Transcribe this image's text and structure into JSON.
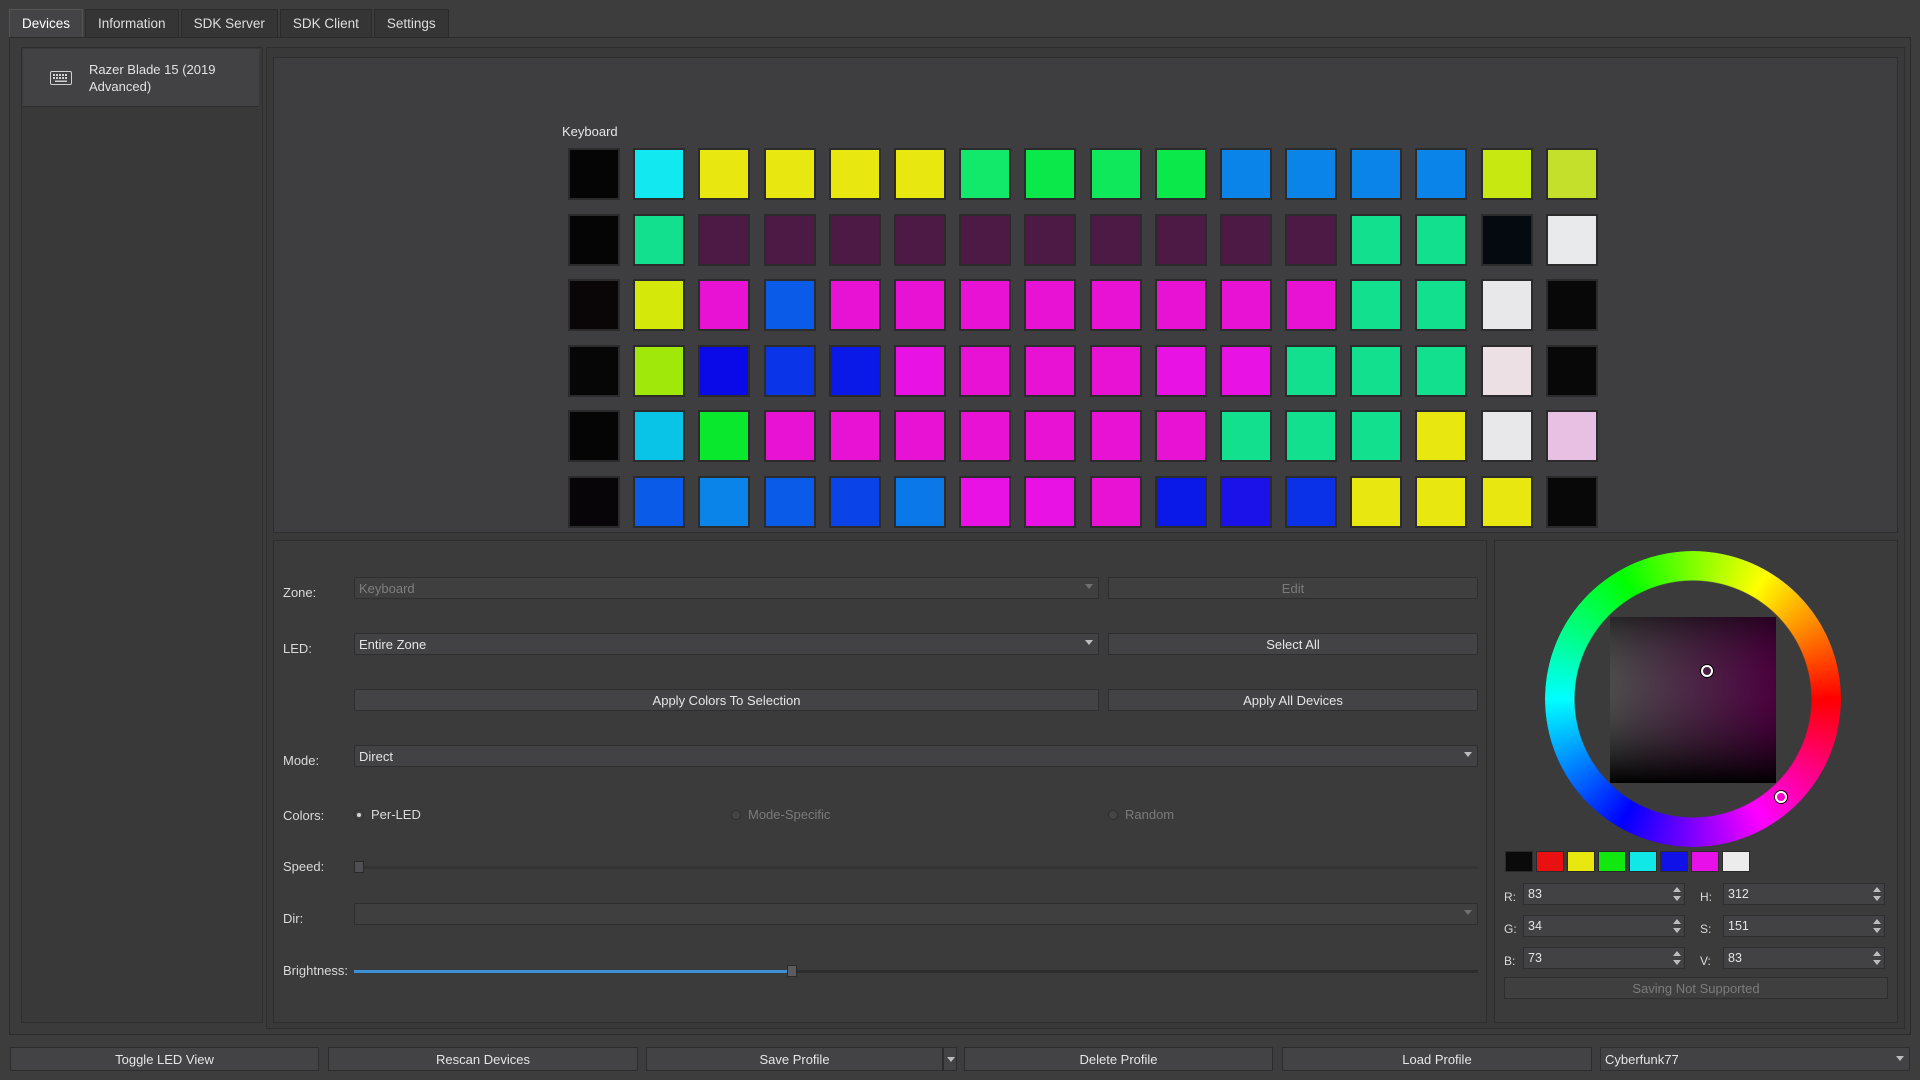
{
  "tabs": [
    {
      "label": "Devices",
      "active": true
    },
    {
      "label": "Information",
      "active": false
    },
    {
      "label": "SDK Server",
      "active": false
    },
    {
      "label": "SDK Client",
      "active": false
    },
    {
      "label": "Settings",
      "active": false
    }
  ],
  "devices": [
    {
      "name": "Razer Blade 15 (2019 Advanced)",
      "icon": "keyboard-icon"
    }
  ],
  "led_view": {
    "zone_label": "Keyboard",
    "rows": [
      [
        "#050505",
        "#12e8ef",
        "#e8e810",
        "#e8e810",
        "#e8e810",
        "#e8e810",
        "#12e86a",
        "#0ae84a",
        "#0ee85a",
        "#0ae84a",
        "#0a84e8",
        "#0a84e8",
        "#0a84e8",
        "#0a84e8",
        "#c8e812",
        "#c4e02a"
      ],
      [
        "#050506",
        "#12e08e",
        "#4c1a44",
        "#4c1a44",
        "#4c1a44",
        "#4c1a44",
        "#4c1a44",
        "#4c1a44",
        "#4c1a44",
        "#4c1a44",
        "#4c1a44",
        "#4c1a44",
        "#12e08e",
        "#12e08e",
        "#050a10",
        "#e8eaec"
      ],
      [
        "#0a0506",
        "#d4e80a",
        "#e812d4",
        "#0a5ce8",
        "#e812d4",
        "#e812d4",
        "#e812d4",
        "#e812d4",
        "#e812d4",
        "#e812d4",
        "#e812d4",
        "#e812d4",
        "#12e08e",
        "#12e08e",
        "#e8e8ea",
        "#080808"
      ],
      [
        "#060607",
        "#a0e80a",
        "#0a0ae8",
        "#0a34e8",
        "#0a18e8",
        "#e812e4",
        "#e812d4",
        "#e812d4",
        "#e812d4",
        "#e812e4",
        "#e812e4",
        "#12e08e",
        "#12e08e",
        "#12e08e",
        "#ece0e4",
        "#080808"
      ],
      [
        "#050506",
        "#0ac4e8",
        "#0ae82e",
        "#e812d4",
        "#e812d4",
        "#e812d4",
        "#e812d4",
        "#e812d4",
        "#e812d4",
        "#e812d4",
        "#12e08e",
        "#12e08e",
        "#12e08e",
        "#e8e810",
        "#e8e8ea",
        "#e8c0e4"
      ],
      [
        "#070508",
        "#0a5ce8",
        "#0a84e8",
        "#0a5ce8",
        "#0a44e8",
        "#0a78e8",
        "#e812e4",
        "#e812e4",
        "#e812d4",
        "#0a18e8",
        "#1a12e8",
        "#0a30e8",
        "#e8e810",
        "#e8e810",
        "#e8e810",
        "#080808"
      ]
    ]
  },
  "controls": {
    "zone": {
      "label": "Zone:",
      "value": "Keyboard",
      "edit_label": "Edit"
    },
    "led": {
      "label": "LED:",
      "value": "Entire Zone",
      "select_all_label": "Select All"
    },
    "apply_selection_label": "Apply Colors To Selection",
    "apply_all_label": "Apply All Devices",
    "mode": {
      "label": "Mode:",
      "value": "Direct"
    },
    "colors": {
      "label": "Colors:",
      "options": [
        "Per-LED",
        "Mode-Specific",
        "Random"
      ],
      "selected": "Per-LED"
    },
    "speed": {
      "label": "Speed:",
      "value": 0
    },
    "dir": {
      "label": "Dir:",
      "value": ""
    },
    "brightness": {
      "label": "Brightness:",
      "value": 0.39
    }
  },
  "picker": {
    "swatches": [
      "#0a0a0a",
      "#e81010",
      "#e8e810",
      "#10e810",
      "#10e8e8",
      "#1010e8",
      "#e810e8",
      "#ececec"
    ],
    "r": {
      "label": "R:",
      "value": "83"
    },
    "g": {
      "label": "G:",
      "value": "34"
    },
    "b": {
      "label": "B:",
      "value": "73"
    },
    "h": {
      "label": "H:",
      "value": "312"
    },
    "s": {
      "label": "S:",
      "value": "151"
    },
    "v": {
      "label": "V:",
      "value": "83"
    },
    "saving_label": "Saving Not Supported"
  },
  "bottom": {
    "toggle_label": "Toggle LED View",
    "rescan_label": "Rescan Devices",
    "save_label": "Save Profile",
    "delete_label": "Delete Profile",
    "load_label": "Load Profile",
    "profile_value": "Cyberfunk77"
  }
}
